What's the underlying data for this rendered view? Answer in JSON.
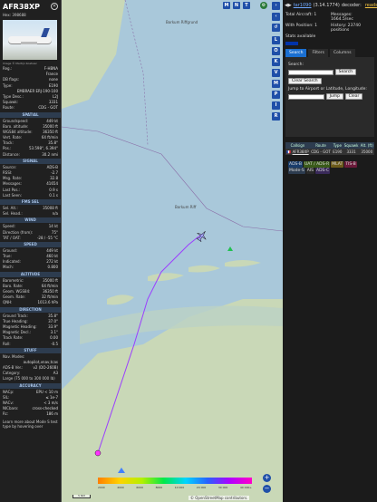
{
  "aircraft": {
    "callsign": "AFR38XP",
    "hex_label": "Hex:",
    "hex": "398688",
    "photo_credit": "Image © Martijn Koetsier",
    "details": [
      {
        "k": "Reg.:",
        "v": "F-HBNA"
      },
      {
        "k": "",
        "v": "France"
      },
      {
        "k": "DB flags:",
        "v": "none"
      },
      {
        "k": "Type:",
        "v": "E190"
      },
      {
        "k": "",
        "v": "EMBRAER ERJ-190-100"
      },
      {
        "k": "Type Desc.:",
        "v": "L2J"
      },
      {
        "k": "Squawk:",
        "v": "3331"
      },
      {
        "k": "Route:",
        "v": "CDG - GOT"
      }
    ],
    "sections": [
      {
        "title": "SPATIAL",
        "rows": [
          {
            "k": "Groundspeed:",
            "v": "449 kt"
          },
          {
            "k": "Baro. altitude:",
            "v": "35000 ft"
          },
          {
            "k": "WGS84 altitude:",
            "v": "36350 ft"
          },
          {
            "k": "Vert. Rate:",
            "v": "64 ft/min"
          },
          {
            "k": "Track:",
            "v": "35.8°"
          },
          {
            "k": "Pos.:",
            "v": "53.598°, 6.394°"
          },
          {
            "k": "Distance:",
            "v": "30.2 nmi"
          }
        ]
      },
      {
        "title": "SIGNAL",
        "rows": [
          {
            "k": "Source:",
            "v": "ADS-B"
          },
          {
            "k": "RSSI:",
            "v": "-2.7"
          },
          {
            "k": "Msg. Rate:",
            "v": "32.8"
          },
          {
            "k": "Messages:",
            "v": "41654"
          },
          {
            "k": "Last Pos.:",
            "v": "0.9 s"
          },
          {
            "k": "Last Seen:",
            "v": "0.1 s"
          }
        ]
      },
      {
        "title": "FMS SEL",
        "rows": [
          {
            "k": "Sel. Alt.:",
            "v": "35008 ft"
          },
          {
            "k": "Sel. Head.:",
            "v": "n/a"
          }
        ]
      },
      {
        "title": "WIND",
        "rows": [
          {
            "k": "Speed:",
            "v": "14 kt"
          },
          {
            "k": "Direction (from):",
            "v": "75°"
          },
          {
            "k": "TAT / OAT:",
            "v": "-28 / -55 °C"
          }
        ]
      },
      {
        "title": "SPEED",
        "rows": [
          {
            "k": "Ground:",
            "v": "449 kt"
          },
          {
            "k": "True:",
            "v": "460 kt"
          },
          {
            "k": "Indicated:",
            "v": "272 kt"
          },
          {
            "k": "Mach:",
            "v": "0.800"
          }
        ]
      },
      {
        "title": "ALTITUDE",
        "rows": [
          {
            "k": "Barometric:",
            "v": "35000 ft"
          },
          {
            "k": "Baro. Rate:",
            "v": "64 ft/min"
          },
          {
            "k": "Geom. WGS84:",
            "v": "36350 ft"
          },
          {
            "k": "Geom. Rate:",
            "v": "32 ft/min"
          },
          {
            "k": "QNH:",
            "v": "1013.6 hPa"
          }
        ]
      },
      {
        "title": "DIRECTION",
        "rows": [
          {
            "k": "Ground Track:",
            "v": "35.8°"
          },
          {
            "k": "True Heading:",
            "v": "37.0°"
          },
          {
            "k": "Magnetic Heading:",
            "v": "33.9°"
          },
          {
            "k": "Magnetic Decl.:",
            "v": "3.1°"
          },
          {
            "k": "Track Rate:",
            "v": "0.00"
          },
          {
            "k": "Roll:",
            "v": "-0.5"
          }
        ]
      },
      {
        "title": "STUFF",
        "rows": [
          {
            "k": "Nav. Modes:",
            "v": ""
          },
          {
            "k": "",
            "v": "autopilot,vnav,tcas"
          },
          {
            "k": "ADS-B Ver.:",
            "v": "v2 (DO-260B)"
          },
          {
            "k": "Category:",
            "v": "A3"
          },
          {
            "k": "Large (75 000 to 300 000 lb)",
            "v": ""
          }
        ]
      },
      {
        "title": "ACCURACY",
        "rows": [
          {
            "k": "NACp:",
            "v": "EPU < 10 m"
          },
          {
            "k": "SIL:",
            "v": "≤ 1e-7"
          },
          {
            "k": "NACv:",
            "v": "< 3 m/s"
          },
          {
            "k": "NICbaro:",
            "v": "cross-checked"
          },
          {
            "k": "Rc:",
            "v": "186 m"
          }
        ]
      }
    ],
    "footnote": "Learn more about Mode S test type by hovering over"
  },
  "map": {
    "labels": [
      {
        "t": "Borkum Riffgrund"
      },
      {
        "t": "Borkum Riff"
      }
    ],
    "top_controls": [
      "M",
      "N",
      "T"
    ],
    "side_controls": [
      "L",
      "O",
      "K",
      "V",
      "M",
      "P",
      "I",
      "R"
    ],
    "legend_ticks": [
      "2000",
      "4000",
      "6000",
      "8000",
      "10 000",
      "20 000",
      "30 000",
      "40 000+"
    ],
    "scale_label": "5 NM",
    "attribution": "© OpenStreetMap contributors."
  },
  "right": {
    "title_link": "tar1090",
    "version": "(3.14.1774)",
    "decoder": "decoder:",
    "update_link": "readsb",
    "stats": [
      {
        "k": "Total Aircraft:",
        "v": "1"
      },
      {
        "k": "Messages:",
        "v": "1664.5/sec"
      },
      {
        "k": "With Position:",
        "v": "1"
      },
      {
        "k": "History:",
        "v": "23740 positions"
      },
      {
        "k": "Stats available",
        "v": ""
      }
    ],
    "tabs": [
      "Search",
      "Filters",
      "Columns"
    ],
    "search_label": "Search:",
    "search_btn": "Search",
    "clear_btn": "Clear Search",
    "jump_label": "Jump to Airport or Latitude, Longitude:",
    "jump_btn": "Jump",
    "clear2_btn": "Clear",
    "columns": [
      "Callsign",
      "Route",
      "Type",
      "Squawk",
      "Alt. (ft)"
    ],
    "rows": [
      {
        "callsign": "AFR38XP",
        "route": "CDG - GOT",
        "type": "E190",
        "squawk": "3331",
        "alt": "35000"
      }
    ],
    "source_tags": [
      {
        "t": "ADS-B",
        "c": "#1a3d6b"
      },
      {
        "t": "UAT / ADS-R",
        "c": "#3a5a1a"
      },
      {
        "t": "MLAT",
        "c": "#6b5a1a"
      },
      {
        "t": "TIS-B",
        "c": "#6b1a3a"
      },
      {
        "t": "Mode-S",
        "c": "#2d3c4f"
      },
      {
        "t": "AIS",
        "c": "#2a2a2a"
      },
      {
        "t": "ADS-C",
        "c": "#3a2a5a"
      }
    ]
  },
  "colors": {
    "accent": "#1f4fa8",
    "section": "#2d3c4f",
    "sea": "#a9c8da",
    "land": "#c9d8b7"
  }
}
